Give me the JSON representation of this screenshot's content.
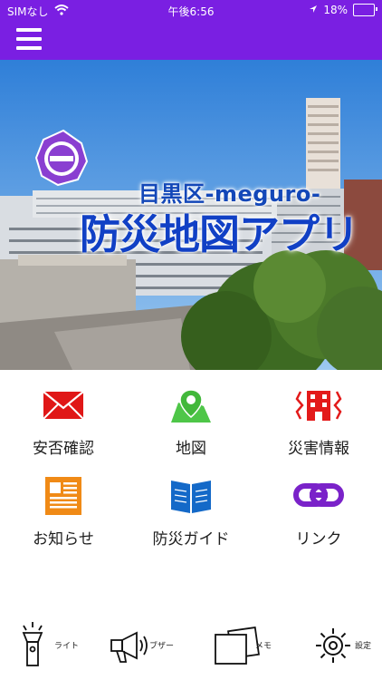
{
  "status": {
    "carrier": "SIMなし",
    "time": "午後6:56",
    "battery_percent": "18%",
    "battery_level": 0.18
  },
  "header": {
    "menu_icon": "hamburger-icon"
  },
  "hero": {
    "title_small": "目黒区-meguro-",
    "title_large": "防災地図アプリ",
    "emblem": "meguro-city-emblem"
  },
  "menu": {
    "items": [
      {
        "label": "安否確認",
        "icon": "envelope-icon",
        "color": "#e01717"
      },
      {
        "label": "地図",
        "icon": "map-pin-icon",
        "color": "#4ec648"
      },
      {
        "label": "災害情報",
        "icon": "disaster-building-icon",
        "color": "#e31a1a"
      },
      {
        "label": "お知らせ",
        "icon": "newspaper-icon",
        "color": "#f08a16"
      },
      {
        "label": "防災ガイド",
        "icon": "book-icon",
        "color": "#1469c8"
      },
      {
        "label": "リンク",
        "icon": "link-icon",
        "color": "#7a22c9"
      }
    ]
  },
  "toolbar": {
    "items": [
      {
        "label": "ライト",
        "icon": "flashlight-icon"
      },
      {
        "label": "ブザー",
        "icon": "buzzer-icon"
      },
      {
        "label": "メモ",
        "icon": "memo-icon"
      },
      {
        "label": "設定",
        "icon": "gear-icon"
      }
    ]
  },
  "colors": {
    "brand": "#7a1fe2",
    "title_blue": "#1140c5"
  }
}
